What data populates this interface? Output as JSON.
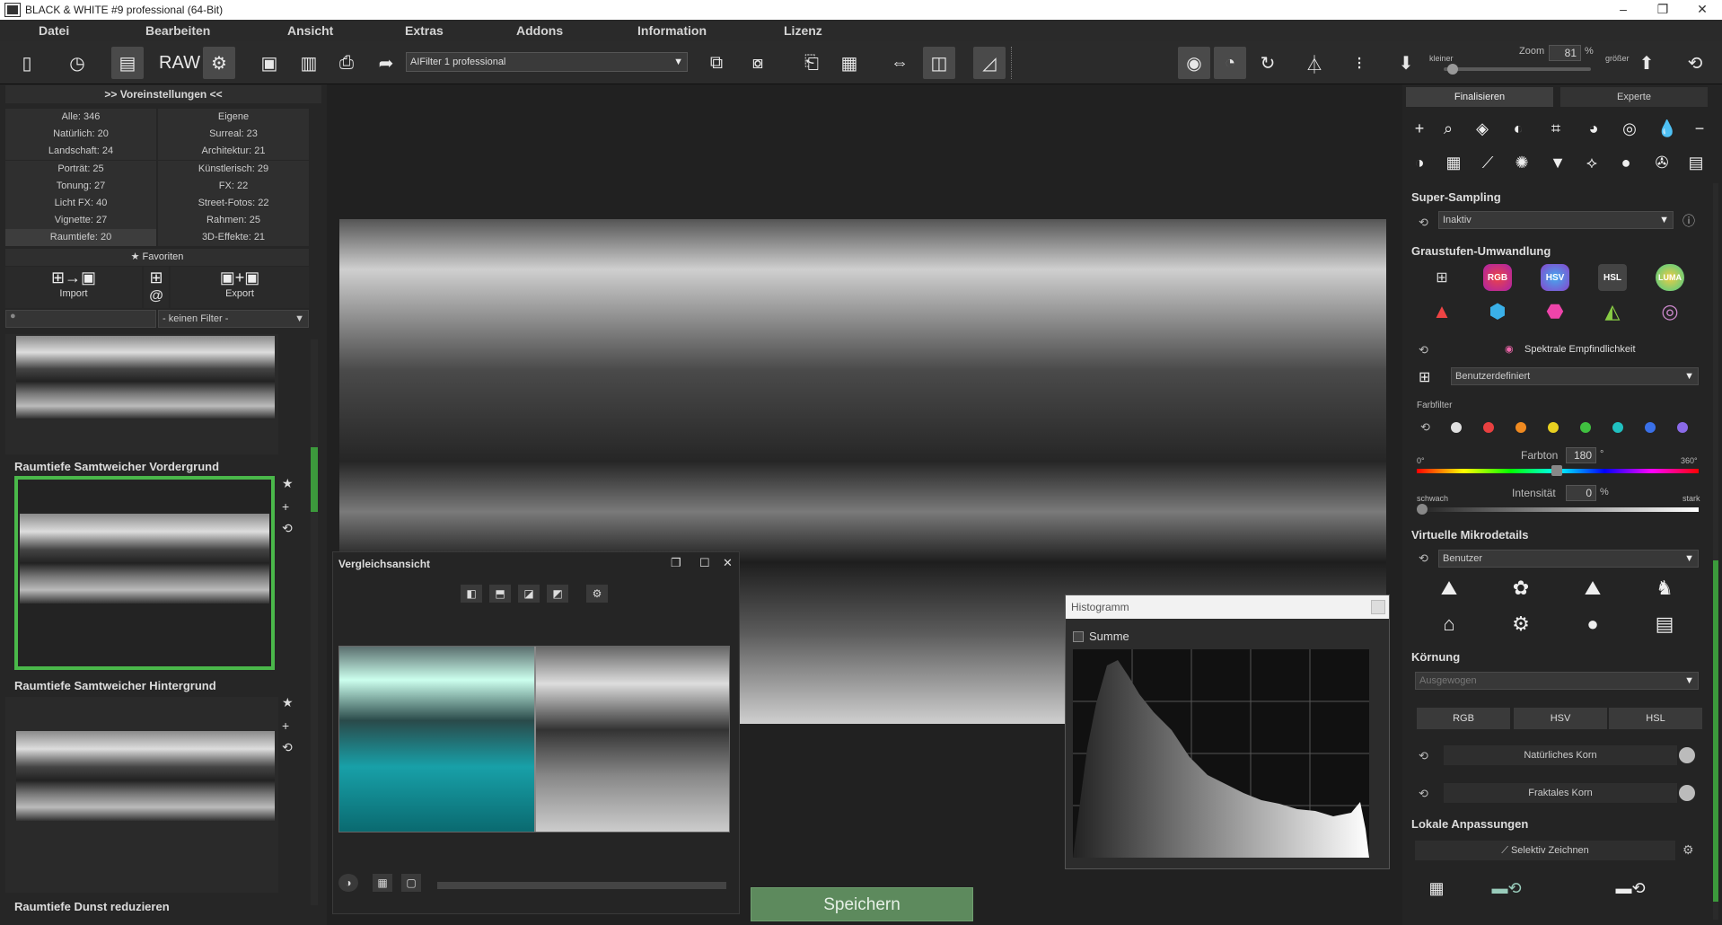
{
  "window": {
    "title": "BLACK & WHITE #9 professional (64-Bit)"
  },
  "menu": [
    "Datei",
    "Bearbeiten",
    "Ansicht",
    "Extras",
    "Addons",
    "Information",
    "Lizenz"
  ],
  "toolbar": {
    "filter_select": "AIFilter 1 professional",
    "zoom_label": "Zoom",
    "zoom_value": "81",
    "zoom_unit": "%",
    "smaller_label": "kleiner",
    "larger_label": "größer"
  },
  "presets": {
    "header": ">> Voreinstellungen <<",
    "categories": [
      [
        "Alle: 346",
        "Eigene"
      ],
      [
        "Natürlich: 20",
        "Surreal: 23"
      ],
      [
        "Landschaft: 24",
        "Architektur: 21"
      ],
      [
        "Porträt: 25",
        "Künstlerisch: 29"
      ],
      [
        "Tonung: 27",
        "FX: 22"
      ],
      [
        "Licht FX: 40",
        "Street-Fotos: 22"
      ],
      [
        "Vignette: 27",
        "Rahmen: 25"
      ],
      [
        "Raumtiefe: 20",
        "3D-Effekte: 21"
      ]
    ],
    "favorites": "Favoriten",
    "import_label": "Import",
    "export_label": "Export",
    "filter_dropdown": "- keinen Filter -",
    "items": [
      {
        "title": "Raumtiefe Samtweicher Vordergrund"
      },
      {
        "title": "Raumtiefe Samtweicher Hintergrund"
      },
      {
        "title": "Raumtiefe Dunst reduzieren"
      }
    ]
  },
  "compare": {
    "title": "Vergleichsansicht"
  },
  "histogram": {
    "title": "Histogramm",
    "checkbox_label": "Summe"
  },
  "save_button": "Speichern",
  "right": {
    "tabs": [
      "Finalisieren",
      "Experte"
    ],
    "supersampling": {
      "title": "Super-Sampling",
      "value": "Inaktiv"
    },
    "grayscale": {
      "title": "Graustufen-Umwandlung",
      "icons": [
        "RGB",
        "HSV",
        "HSL",
        "LUMA"
      ],
      "spectral_label": "Spektrale Empfindlichkeit",
      "preset_value": "Benutzerdefiniert",
      "colorfilter_label": "Farbfilter",
      "hue_min": "0°",
      "hue_label": "Farbton",
      "hue_value": "180",
      "hue_unit": "°",
      "hue_max": "360°",
      "weak_label": "schwach",
      "intensity_label": "Intensität",
      "intensity_value": "0",
      "intensity_unit": "%",
      "strong_label": "stark",
      "filter_colors": [
        "#e0e0e0",
        "#e84040",
        "#f08a20",
        "#e8d020",
        "#40c040",
        "#20c0c0",
        "#3a70e8",
        "#8a6ae8"
      ]
    },
    "microdetails": {
      "title": "Virtuelle Mikrodetails",
      "value": "Benutzer"
    },
    "grain": {
      "title": "Körnung",
      "value": "Ausgewogen",
      "modes": [
        "RGB",
        "HSV",
        "HSL"
      ],
      "natural": "Natürliches Korn",
      "fractal": "Fraktales Korn"
    },
    "local": {
      "title": "Lokale Anpassungen",
      "draw": "Selektiv Zeichnen"
    }
  },
  "colors": {
    "accent_green": "#3c9a3c",
    "save_green": "#5d8a5d"
  }
}
